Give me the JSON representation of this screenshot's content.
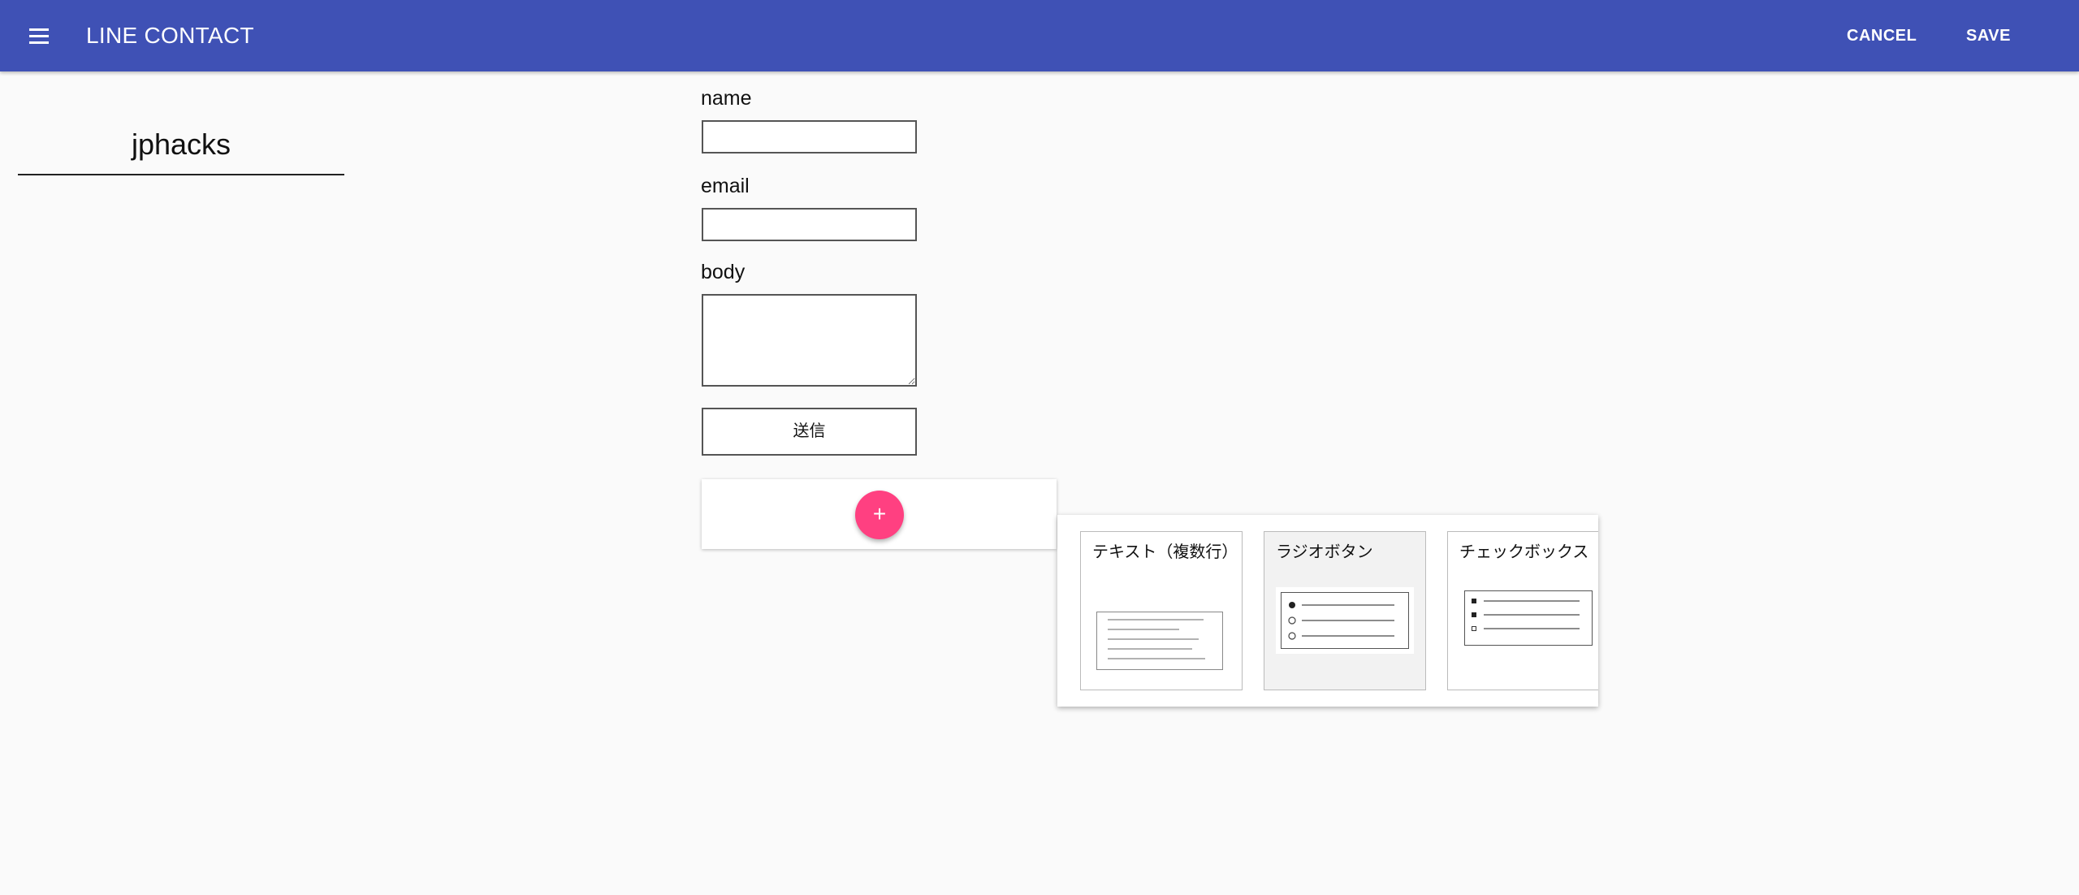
{
  "app_bar": {
    "title": "LINE CONTACT",
    "menu_icon": "hamburger-menu-icon",
    "cancel_label": "CANCEL",
    "save_label": "SAVE",
    "background_color": "#3f51b5"
  },
  "form": {
    "name": "jphacks"
  },
  "fields": [
    {
      "label": "name"
    },
    {
      "label": "email"
    },
    {
      "label": "body"
    }
  ],
  "submit_label": "送信",
  "add_button": {
    "label": "+",
    "color": "#ff4081"
  },
  "field_types": [
    {
      "label": "テキスト（複数行）",
      "icon": "multiline-text-preview-icon",
      "selected": false
    },
    {
      "label": "ラジオボタン",
      "icon": "radio-button-preview-icon",
      "selected": true
    },
    {
      "label": "チェックボックス",
      "icon": "checkbox-preview-icon",
      "selected": false
    }
  ]
}
